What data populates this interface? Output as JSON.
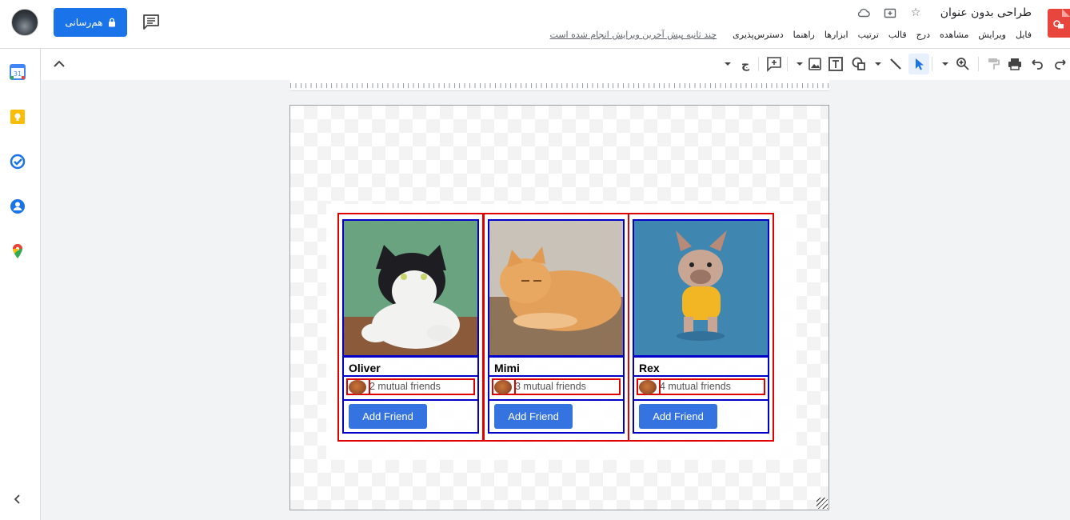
{
  "header": {
    "title": "طراحی بدون عنوان",
    "menu": [
      "فایل",
      "ویرایش",
      "مشاهده",
      "درج",
      "قالب",
      "ترتیب",
      "ابزارها",
      "راهنما",
      "دسترس‌پذیری"
    ],
    "last_edit": "چند ثانیه پیش آخرین ویرایش انجام شده است",
    "share_label": "هم‌رسانی"
  },
  "toolbar": {
    "icons": [
      "redo-icon",
      "undo-icon",
      "print-icon",
      "paint-format-icon",
      "zoom-icon",
      "select-icon",
      "line-icon",
      "shape-icon",
      "textbox-icon",
      "image-icon",
      "comment-add-icon",
      "input-tools-icon"
    ]
  },
  "sidepanel": {
    "apps": [
      "calendar-icon",
      "keep-icon",
      "tasks-icon",
      "contacts-icon",
      "maps-icon"
    ]
  },
  "cards": [
    {
      "name": "Oliver",
      "mutual": "2 mutual friends",
      "button": "Add Friend"
    },
    {
      "name": "Mimi",
      "mutual": "3 mutual friends",
      "button": "Add Friend"
    },
    {
      "name": "Rex",
      "mutual": "4 mutual friends",
      "button": "Add Friend"
    }
  ],
  "colors": {
    "accent": "#1a73e8",
    "button": "#3574e0",
    "outline_red": "#e00000",
    "outline_blue": "#0000c8"
  }
}
